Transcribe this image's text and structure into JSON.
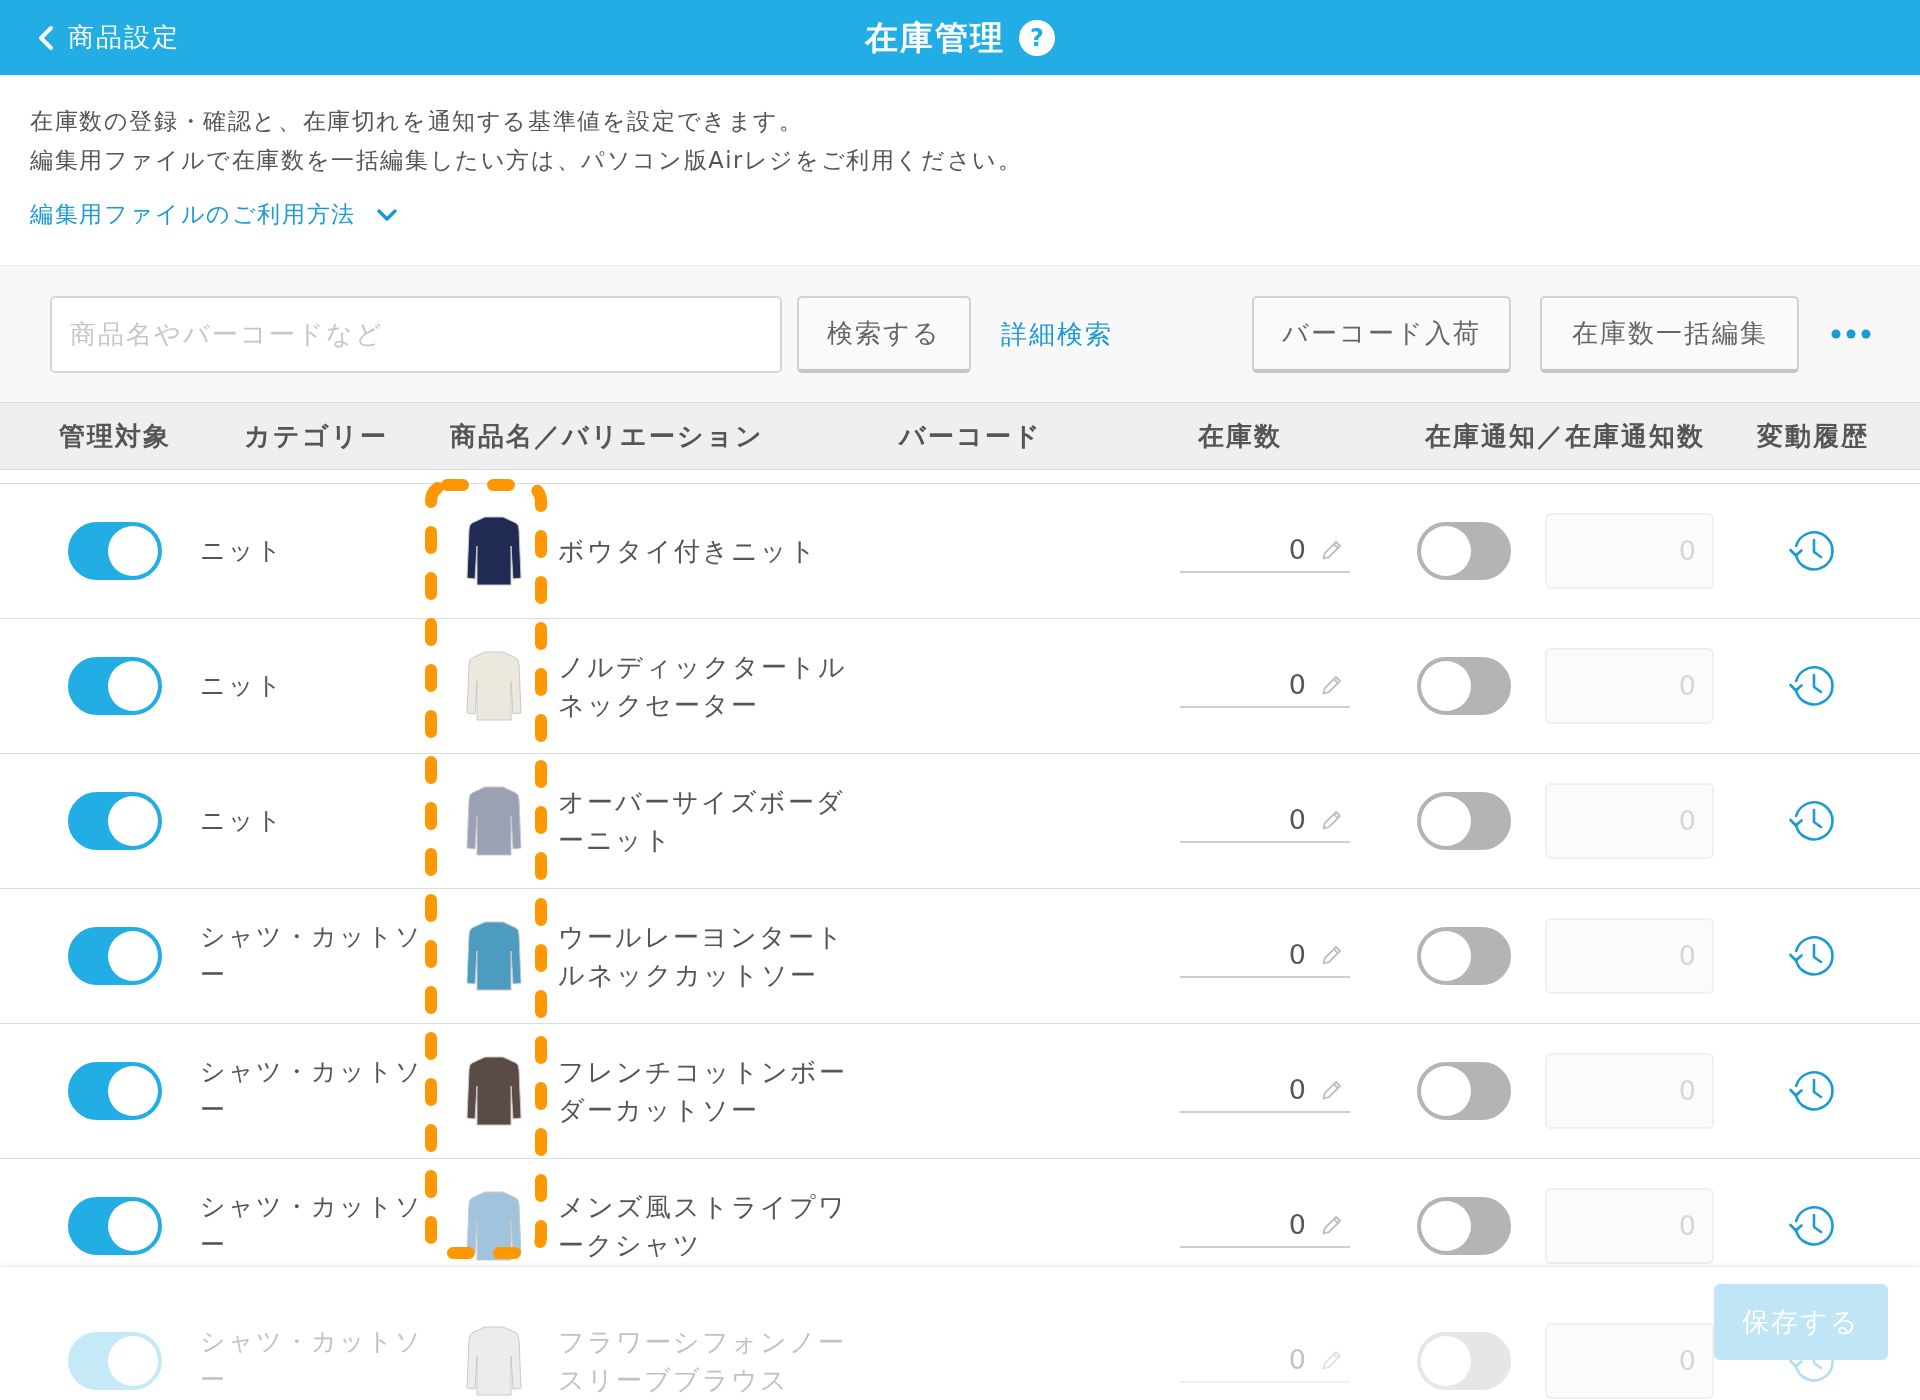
{
  "header": {
    "back_label": "商品設定",
    "title": "在庫管理",
    "help_symbol": "?"
  },
  "intro": {
    "lines": [
      "在庫数の登録・確認と、在庫切れを通知する基準値を設定できます。",
      "編集用ファイルで在庫数を一括編集したい方は、パソコン版Airレジをご利用ください。"
    ],
    "help_link": {
      "label": "編集用ファイルのご利用方法",
      "expanded": false
    }
  },
  "toolbar": {
    "search": {
      "placeholder": "商品名やバーコードなど"
    },
    "search_button": "検索する",
    "advanced_search_link": "詳細検索",
    "buttons": [
      "バーコード入荷",
      "在庫数一括編集"
    ]
  },
  "table": {
    "columns": [
      "管理対象",
      "カテゴリー",
      "商品名／バリエーション",
      "バーコード",
      "在庫数",
      "在庫通知／在庫通知数",
      "変動履歴"
    ],
    "rows": [
      {
        "managed": true,
        "category": "ニット",
        "color": "#1f2b52",
        "name": "ボウタイ付きニット",
        "stock": "0",
        "notify_on": false,
        "notify_count": "0"
      },
      {
        "managed": true,
        "category": "ニット",
        "color": "#ece8de",
        "name": "ノルディックタートルネックセーター",
        "stock": "0",
        "notify_on": false,
        "notify_count": "0"
      },
      {
        "managed": true,
        "category": "ニット",
        "color": "#9aa1b3",
        "name": "オーバーサイズボーダーニット",
        "stock": "0",
        "notify_on": false,
        "notify_count": "0"
      },
      {
        "managed": true,
        "category": "シャツ・カットソー",
        "color": "#4d9cbf",
        "name": "ウールレーヨンタートルネックカットソー",
        "stock": "0",
        "notify_on": false,
        "notify_count": "0"
      },
      {
        "managed": true,
        "category": "シャツ・カットソー",
        "color": "#5a4b46",
        "name": "フレンチコットンボーダーカットソー",
        "stock": "0",
        "notify_on": false,
        "notify_count": "0"
      },
      {
        "managed": true,
        "category": "シャツ・カットソー",
        "color": "#9fc4dc",
        "name": "メンズ風ストライプワークシャツ",
        "stock": "0",
        "notify_on": false,
        "notify_count": "0"
      },
      {
        "managed": true,
        "category": "シャツ・カットソー",
        "color": "#ececec",
        "name": "フラワーシフォンノースリーブブラウス",
        "stock": "0",
        "notify_on": false,
        "notify_count": "0"
      }
    ]
  },
  "footer": {
    "save_button": {
      "label": "保存する",
      "disabled": true
    }
  }
}
